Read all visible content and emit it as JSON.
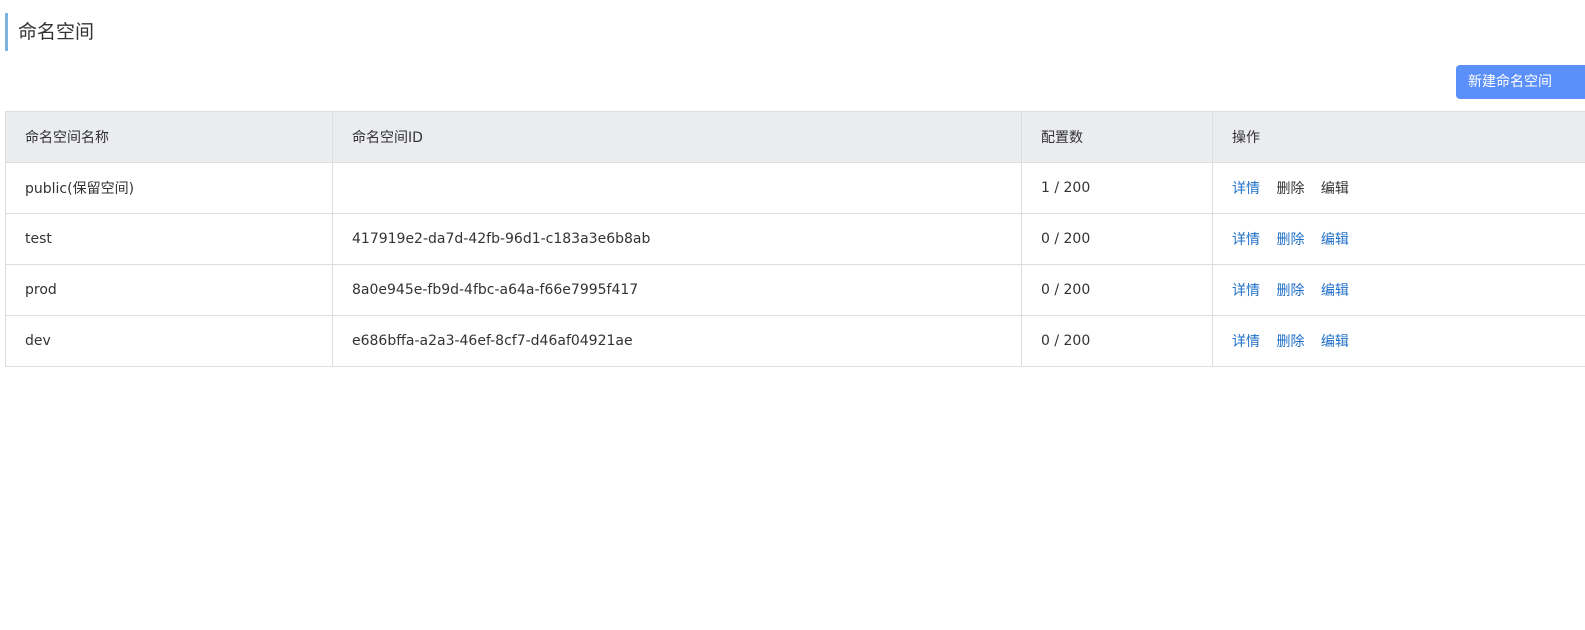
{
  "page": {
    "title": "命名空间"
  },
  "toolbar": {
    "new_label": "新建命名空间"
  },
  "table": {
    "headers": [
      "命名空间名称",
      "命名空间ID",
      "配置数",
      "操作"
    ],
    "rows": [
      {
        "name": "public(保留空间)",
        "id": "",
        "count": "1 / 200",
        "actions": [
          "详情",
          "删除",
          "编辑"
        ],
        "disabled": true
      },
      {
        "name": "test",
        "id": "417919e2-da7d-42fb-96d1-c183a3e6b8ab",
        "count": "0 / 200",
        "actions": [
          "详情",
          "删除",
          "编辑"
        ],
        "disabled": false
      },
      {
        "name": "prod",
        "id": "8a0e945e-fb9d-4fbc-a64a-f66e7995f417",
        "count": "0 / 200",
        "actions": [
          "详情",
          "删除",
          "编辑"
        ],
        "disabled": false
      },
      {
        "name": "dev",
        "id": "e686bffa-a2a3-46ef-8cf7-d46af04921ae",
        "count": "0 / 200",
        "actions": [
          "详情",
          "删除",
          "编辑"
        ],
        "disabled": false
      }
    ]
  },
  "colors": {
    "accent_button": "#5b8ff9",
    "link": "#1f6fc8",
    "header_bg": "#ebecf0",
    "title_bar": "#7fb3dc"
  }
}
